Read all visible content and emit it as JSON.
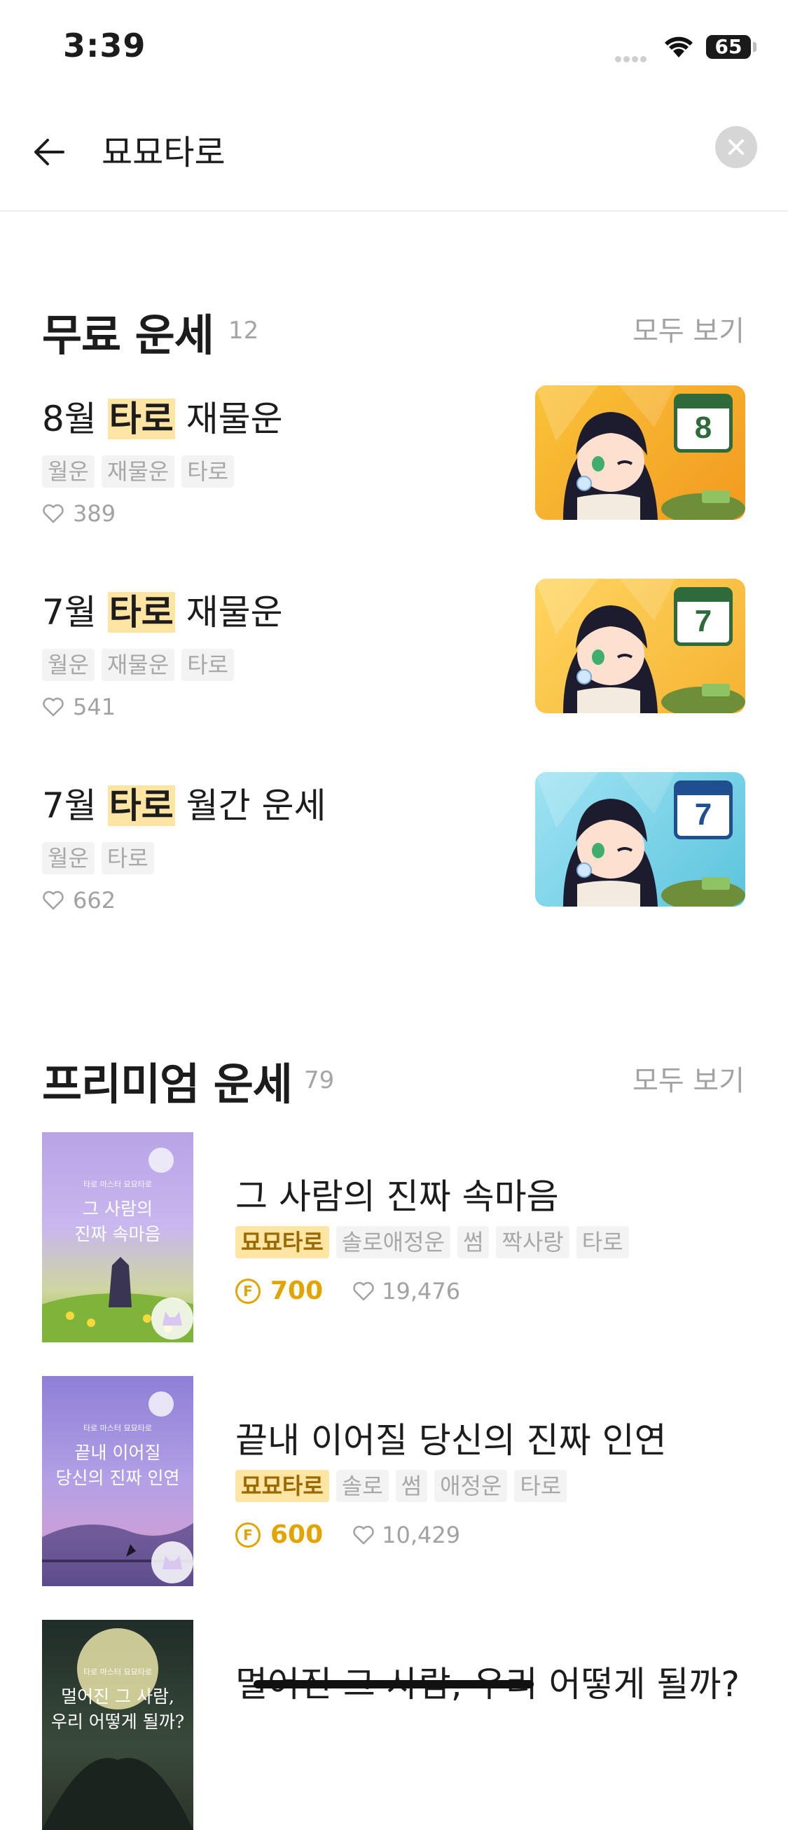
{
  "status": {
    "time": "3:39",
    "battery": "65"
  },
  "search": {
    "query": "묘묘타로"
  },
  "free_section": {
    "title": "무료 운세",
    "count": "12",
    "see_all": "모두 보기",
    "items": [
      {
        "prefix": "8월 ",
        "highlight": "타로",
        "suffix": " 재물운",
        "tags": [
          "월운",
          "재물운",
          "타로"
        ],
        "likes": "389",
        "badge": "8"
      },
      {
        "prefix": "7월 ",
        "highlight": "타로",
        "suffix": " 재물운",
        "tags": [
          "월운",
          "재물운",
          "타로"
        ],
        "likes": "541",
        "badge": "7"
      },
      {
        "prefix": "7월 ",
        "highlight": "타로",
        "suffix": " 월간 운세",
        "tags": [
          "월운",
          "타로"
        ],
        "likes": "662",
        "badge": "7"
      }
    ]
  },
  "premium_section": {
    "title": "프리미엄 운세",
    "count": "79",
    "see_all": "모두 보기",
    "items": [
      {
        "title": "그 사람의 진짜 속마음",
        "brand_tag": "묘묘타로",
        "tags": [
          "솔로애정운",
          "썸",
          "짝사랑",
          "타로"
        ],
        "price": "700",
        "likes": "19,476",
        "cover_small": "타로 마스터 묘묘타로",
        "cover_line1": "그 사람의",
        "cover_line2": "진짜 속마음"
      },
      {
        "title": "끝내 이어질 당신의 진짜 인연",
        "brand_tag": "묘묘타로",
        "tags": [
          "솔로",
          "썸",
          "애정운",
          "타로"
        ],
        "price": "600",
        "likes": "10,429",
        "cover_small": "타로 마스터 묘묘타로",
        "cover_line1": "끝내 이어질",
        "cover_line2": "당신의 진짜 인연"
      },
      {
        "title": "멀어진 그 사람, 우리 어떻게 될까?",
        "cover_small": "타로 마스터 묘묘타로",
        "cover_line1": "멀어진 그 사람,",
        "cover_line2": "우리 어떻게 될까?"
      }
    ]
  },
  "coin_symbol": "F",
  "colors": {
    "highlight": "#ffe5a3",
    "price": "#e1a400",
    "muted": "#a3a3a3"
  }
}
